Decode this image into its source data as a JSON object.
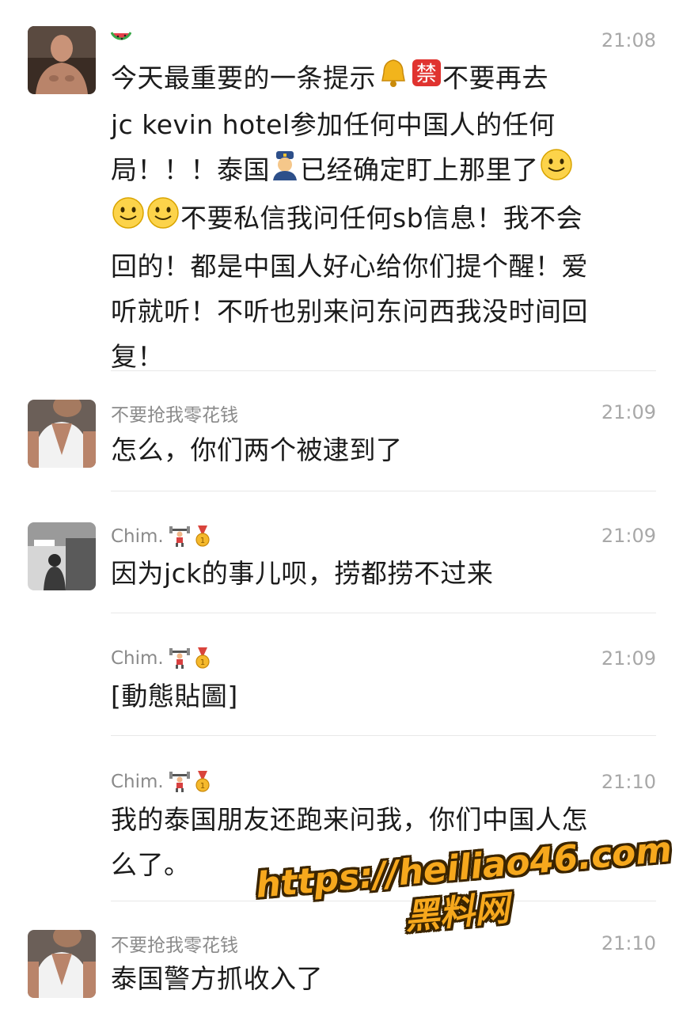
{
  "messages": [
    {
      "sender": "",
      "sender_icon": "watermelon-icon",
      "time": "21:08",
      "text_parts": {
        "p1": "今天最重要的一条提示",
        "p2": "不要再去\njc kevin hotel参加任何中国人的任何\n局！！！泰国",
        "p3": "已经确定盯上那里了",
        "p4": "不要私信我问任何sb信息！我不会\n回的！都是中国人好心给你们提个醒！爱\n听就听！不听也别来问东问西我没时间回\n复！"
      }
    },
    {
      "sender": "不要抢我零花钱",
      "time": "21:09",
      "text": "怎么，你们两个被逮到了"
    },
    {
      "sender": "Chim.",
      "time": "21:09",
      "text": "因为jck的事儿呗，捞都捞不过来"
    },
    {
      "sender": "Chim.",
      "time": "21:09",
      "text": "[動態貼圖]"
    },
    {
      "sender": "Chim.",
      "time": "21:10",
      "text": "我的泰国朋友还跑来问我，你们中国人怎\n么了。"
    },
    {
      "sender": "不要抢我零花钱",
      "time": "21:10",
      "text": "泰国警方抓收入了"
    }
  ],
  "badges": [
    "weightlifter-icon",
    "gold-medal-icon"
  ],
  "watermark": {
    "url": "https://heiliao46.com",
    "name": "黑料网"
  }
}
